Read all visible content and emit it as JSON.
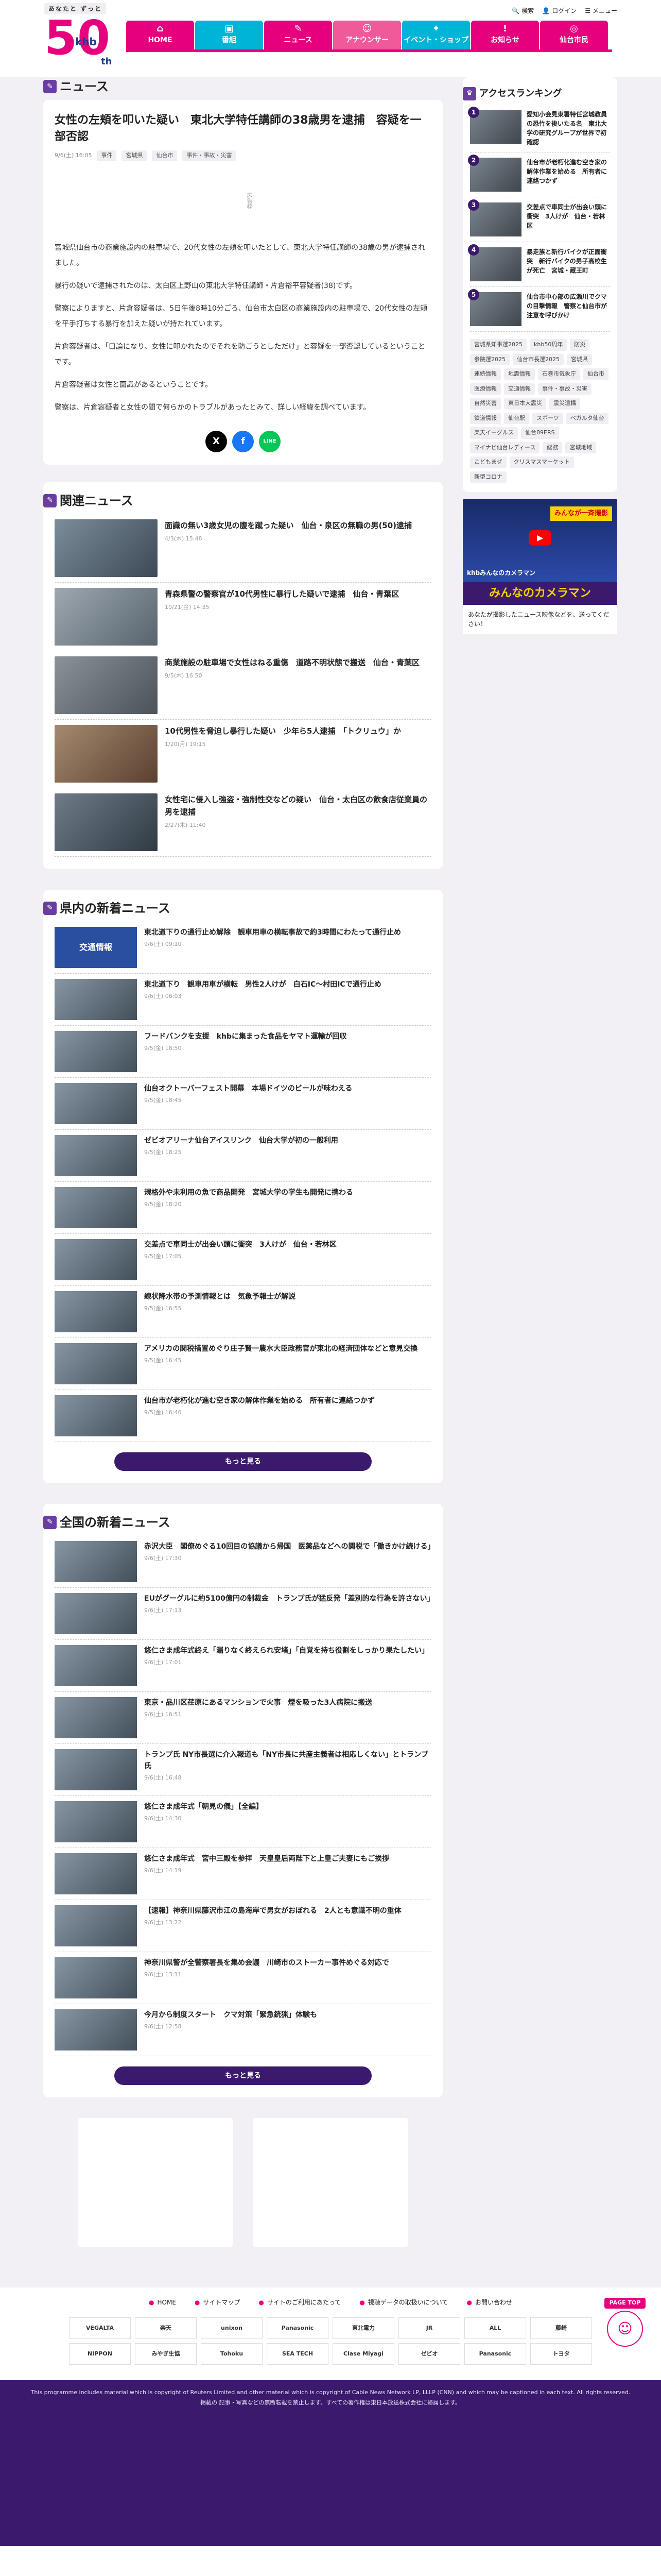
{
  "header": {
    "tagline": "あなたと ずっと",
    "logo_text": "50",
    "brand": "khb",
    "anniv": "th",
    "utility": [
      {
        "icon": "search-icon",
        "label": "検索"
      },
      {
        "icon": "login-icon",
        "label": "ログイン"
      },
      {
        "icon": "menu-icon",
        "label": "メニュー"
      }
    ],
    "nav": [
      {
        "icon": "home-icon",
        "label": "HOME"
      },
      {
        "icon": "tv-icon",
        "label": "番組"
      },
      {
        "icon": "news-icon",
        "label": "ニュース"
      },
      {
        "icon": "announcer-icon",
        "label": "アナウンサー"
      },
      {
        "icon": "event-icon",
        "label": "イベント・ショップ"
      },
      {
        "icon": "info-icon",
        "label": "お知らせ"
      },
      {
        "icon": "sendai-icon",
        "label": "仙台市民"
      }
    ]
  },
  "section_news": "ニュース",
  "article": {
    "title": "女性の左頬を叩いた疑い　東北大学特任講師の38歳男を逮捕　容疑を一部否認",
    "date": "9/6(土) 16:05",
    "tags": [
      "事件",
      "宮城県",
      "仙台市",
      "事件・事故・災害"
    ],
    "ad_label": "広告枠",
    "paragraphs": [
      "宮城県仙台市の商業施設内の駐車場で、20代女性の左頬を叩いたとして、東北大学特任講師の38歳の男が逮捕されました。",
      "暴行の疑いで逮捕されたのは、太白区上野山の東北大学特任講師・片倉裕平容疑者(38)です。",
      "警察によりますと、片倉容疑者は、5日午後8時10分ごろ、仙台市太白区の商業施設内の駐車場で、20代女性の左頬を平手打ちする暴行を加えた疑いが持たれています。",
      "片倉容疑者は、「口論になり、女性に叩かれたのでそれを防ごうとしただけ」と容疑を一部否認しているということです。",
      "片倉容疑者は女性と面識があるということです。",
      "警察は、片倉容疑者と女性の間で何らかのトラブルがあったとみて、詳しい経緯を調べています。"
    ]
  },
  "share": [
    {
      "icon": "x-icon",
      "label": "X"
    },
    {
      "icon": "facebook-icon",
      "label": "f"
    },
    {
      "icon": "line-icon",
      "label": "LINE"
    }
  ],
  "related": {
    "title": "関連ニュース",
    "items": [
      {
        "title": "面識の無い3歳女児の腹を蹴った疑い　仙台・泉区の無職の男(50)逮捕",
        "date": "4/3(木) 15:48"
      },
      {
        "title": "青森県警の警察官が10代男性に暴行した疑いで逮捕　仙台・青葉区",
        "date": "10/21(金) 14:35"
      },
      {
        "title": "商業施設の駐車場で女性はねる重傷　道路不明状態で搬送　仙台・青葉区",
        "date": "9/5(木) 16:50"
      },
      {
        "title": "10代男性を脅迫し暴行した疑い　少年ら5人逮捕　「トクリュウ」か",
        "date": "1/20(月) 19:15"
      },
      {
        "title": "女性宅に侵入し強盗・強制性交などの疑い　仙台・太白区の飲食店従業員の男を逮捕",
        "date": "2/27(木) 11:40"
      }
    ]
  },
  "pref": {
    "title": "県内の新着ニュース",
    "more": "もっと見る",
    "items": [
      {
        "title": "東北道下りの通行止め解除　観車用車の横転事故で約3時間にわたって通行止め",
        "date": "9/6(土) 09:10",
        "thumb": "交通情報"
      },
      {
        "title": "東北道下り　観車用車が横転　男性2人けが　白石IC〜村田ICで通行止め",
        "date": "9/6(土) 06:03",
        "thumb": ""
      },
      {
        "title": "フードバンクを支援　khbに集まった食品をヤマト運輸が回収",
        "date": "9/5(金) 18:50",
        "thumb": ""
      },
      {
        "title": "仙台オクトーバーフェスト開幕　本場ドイツのビールが味わえる",
        "date": "9/5(金) 18:45",
        "thumb": ""
      },
      {
        "title": "ゼビオアリーナ仙台アイスリンク　仙台大学が初の一般利用",
        "date": "9/5(金) 18:25",
        "thumb": ""
      },
      {
        "title": "規格外や未利用の魚で商品開発　宮城大学の学生も開発に携わる",
        "date": "9/5(金) 18:20",
        "thumb": ""
      },
      {
        "title": "交差点で車同士が出会い頭に衝突　3人けが　仙台・若林区",
        "date": "9/5(金) 17:05",
        "thumb": ""
      },
      {
        "title": "線状降水帯の予測情報とは　気象予報士が解説",
        "date": "9/5(金) 16:55",
        "thumb": ""
      },
      {
        "title": "アメリカの関税措置めぐり庄子賢一農水大臣政務官が東北の経済団体などと意見交換",
        "date": "9/5(金) 16:45",
        "thumb": ""
      },
      {
        "title": "仙台市が老朽化が進む空き家の解体作業を始める　所有者に連絡つかず",
        "date": "9/5(金) 16:40",
        "thumb": ""
      }
    ]
  },
  "national": {
    "title": "全国の新着ニュース",
    "more": "もっと見る",
    "items": [
      {
        "title": "赤沢大臣　閣僚めぐる10回目の協議から帰国　医薬品などへの関税で「働きかけ続ける」",
        "date": "9/6(土) 17:30"
      },
      {
        "title": "EUがグーグルに約5100億円の制裁金　トランプ氏が猛反発「差別的な行為を許さない」",
        "date": "9/6(土) 17:13"
      },
      {
        "title": "悠仁さま成年式終え「漏りなく終えられ安堵」「自覚を持ち役割をしっかり果たしたい」",
        "date": "9/6(土) 17:01"
      },
      {
        "title": "東京・品川区荏原にあるマンションで火事　煙を吸った3人病院に搬送",
        "date": "9/6(土) 16:51"
      },
      {
        "title": "トランプ氏 NY市長選に介入報道も「NY市長に共産主義者は相応しくない」とトランプ氏",
        "date": "9/6(土) 16:48"
      },
      {
        "title": "悠仁さま成年式「朝見の儀」【全編】",
        "date": "9/6(土) 14:30"
      },
      {
        "title": "悠仁さま成年式　宮中三殿を参拝　天皇皇后両陛下と上皇ご夫妻にもご挨拶",
        "date": "9/6(土) 14:19"
      },
      {
        "title": "【速報】神奈川県藤沢市江の島海岸で男女がおぼれる　2人とも意識不明の重体",
        "date": "9/6(土) 13:22"
      },
      {
        "title": "神奈川県警が全警察署長を集め会議　川崎市のストーカー事件めぐる対応で",
        "date": "9/6(土) 13:11"
      },
      {
        "title": "今月から制度スタート　クマ対策「緊急銃猟」体験も",
        "date": "9/6(土) 12:58"
      }
    ]
  },
  "sidebar": {
    "ranking_title": "アクセスランキング",
    "ranking": [
      {
        "title": "愛知小会見東署特任宮城教員の恐竹を後いたる名　東北大学の研究グループが世界で初確認",
        "date": ""
      },
      {
        "title": "仙台市が老朽化進む空き家の解体作業を始める　所有者に連絡つかず",
        "date": ""
      },
      {
        "title": "交差点で車同士が出会い頭に衝突　3人けが　仙台・若林区",
        "date": ""
      },
      {
        "title": "暴走族と新行バイクが正面衝突　新行バイクの男子高校生が死亡　宮城・蔵王町",
        "date": ""
      },
      {
        "title": "仙台市中心部の広瀬川でクマの目撃情報　警察と仙台市が注意を呼びかけ",
        "date": ""
      }
    ],
    "tags": [
      "宮城県知事選2025",
      "khb50周年",
      "防災",
      "参院選2025",
      "仙台市長選2025",
      "宮城県",
      "連続情報",
      "地震情報",
      "石巻市気象庁",
      "仙台市",
      "医療情報",
      "交通情報",
      "事件・事故・災害",
      "自然災害",
      "東日本大震災",
      "震災遺構",
      "鉄道情報",
      "仙台駅",
      "スポーツ",
      "ベガルタ仙台",
      "楽天イーグルス",
      "仙台89ERS",
      "マイナビ仙台レディース",
      "総務",
      "宮城地域",
      "こどもまぜ",
      "クリスマスマーケット",
      "新型コロナ"
    ],
    "banner": {
      "top": "みんなが一斉撮影",
      "mid": "khbみんなのカメラマン",
      "cam": "みんなのカメラマン",
      "caption": "あなたが撮影したニュース映像などを、送ってください！"
    }
  },
  "footer": {
    "nav": [
      "HOME",
      "サイトマップ",
      "サイトのご利用にあたって",
      "視聴データの取扱いについて",
      "お問い合わせ"
    ],
    "sponsors": [
      "VEGALTA",
      "楽天",
      "unixon",
      "Panasonic",
      "東北電力",
      "JR",
      "ALL",
      "藤崎",
      "NIPPON",
      "みやぎ生協",
      "Tohoku",
      "SEA TECH",
      "Clase Miyagi",
      "ゼビオ",
      "Panasonic",
      "トヨタ"
    ],
    "copyright": "This programme includes material which is copyright of Reuters Limited and other material which is copyright of Cable News Network LP, LLLP (CNN) and which may be captioned in each text. All rights reserved.",
    "copyright2": "掲載の 記事・写真などの無断転載を禁止します。すべての著作権は東日本放送株式会社に帰属します。",
    "pagetop": "PAGE TOP"
  }
}
